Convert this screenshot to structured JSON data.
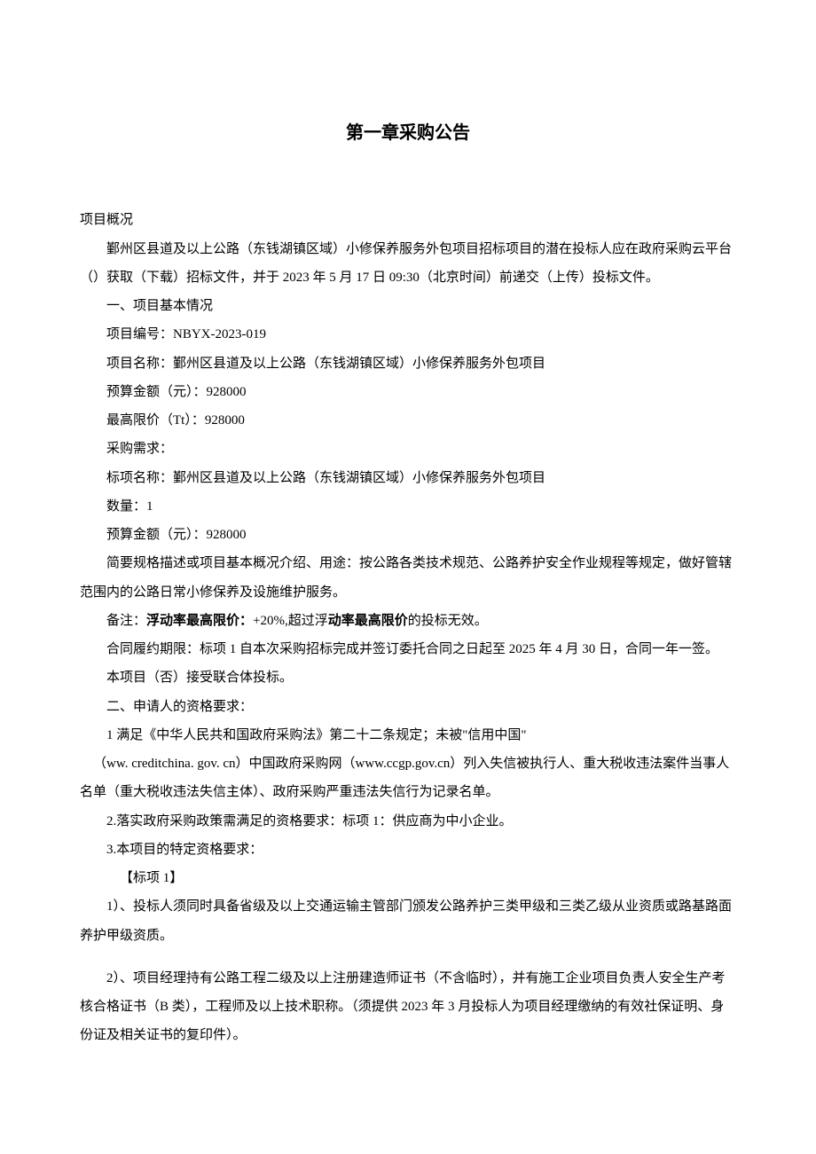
{
  "chapter_title": "第一章采购公告",
  "overview_heading": "项目概况",
  "intro_para": "鄞州区县道及以上公路（东钱湖镇区域）小修保养服务外包项目招标项目的潜在投标人应在政府采购云平台（）获取（下载）招标文件，并于 2023 年 5 月 17 日 09:30（北京时间）前递交（上传）投标文件。",
  "section1_title": "一、项目基本情况",
  "project_number_line": "项目编号：NBYX-2023-019",
  "project_name_line": "项目名称：鄞州区县道及以上公路（东钱湖镇区域）小修保养服务外包项目",
  "budget_line": "预算金额（元）：928000",
  "max_price_line": "最高限价（Tt）：928000",
  "procurement_req_label": "采购需求：",
  "lot_name_line": "标项名称：鄞州区县道及以上公路（东钱湖镇区域）小修保养服务外包项目",
  "quantity_line": "数量：1",
  "lot_budget_line": "预算金额（元）：928000",
  "brief_desc": "简要规格描述或项目基本概况介绍、用途：按公路各类技术规范、公路养护安全作业规程等规定，做好管辖范围内的公路日常小修保养及设施维护服务。",
  "note_prefix": "备注：",
  "note_bold1": "浮动率最高限价：",
  "note_mid": "+20%,超过浮",
  "note_bold2": "动率最高限价",
  "note_suffix": "的投标无效。",
  "contract_period": "合同履约期限：标项 1 自本次采购招标完成并签订委托合同之日起至 2025 年 4 月 30 日，合同一年一签。",
  "consortium_line": "本项目（否）接受联合体投标。",
  "section2_title": "二、申请人的资格要求：",
  "req1_line1": "1 满足《中华人民共和国政府采购法》第二十二条规定；未被\"信用中国\"",
  "req1_line2": "（ww. creditchina. gov. cn）中国政府采购网（www.ccgp.gov.cn）列入失信被执行人、重大税收违法案件当事人名单（重大税收违法失信主体）、政府采购严重违法失信行为记录名单。",
  "req2": "2.落实政府采购政策需满足的资格要求：标项 1：供应商为中小企业。",
  "req3": "3.本项目的特定资格要求：",
  "lot1_label": "【标项 1】",
  "spec_req1": "1）、投标人须同时具备省级及以上交通运输主管部门颁发公路养护三类甲级和三类乙级从业资质或路基路面养护甲级资质。",
  "spec_req2": "2）、项目经理持有公路工程二级及以上注册建造师证书（不含临时），并有施工企业项目负责人安全生产考核合格证书（B 类），工程师及以上技术职称。（须提供 2023 年 3 月投标人为项目经理缴纳的有效社保证明、身份证及相关证书的复印件）。"
}
